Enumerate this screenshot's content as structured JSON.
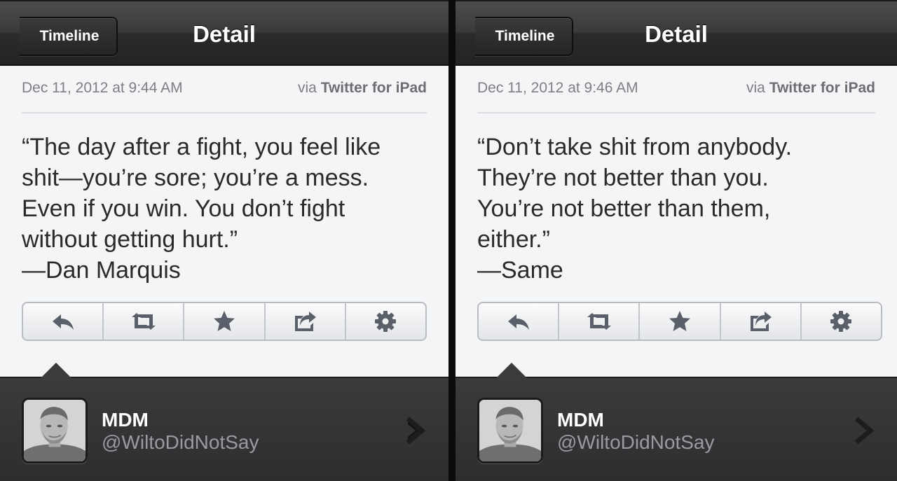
{
  "screens": [
    {
      "nav": {
        "back_label": "Timeline",
        "title": "Detail"
      },
      "tweet": {
        "date": "Dec 11, 2012 at 9:44 AM",
        "via_prefix": "via",
        "via_source": "Twitter for iPad",
        "lines": [
          "“The day after a fight, you feel like",
          "shit—you’re sore; you’re a mess.",
          "Even if you win. You don’t fight",
          "without getting hurt.”",
          "—Dan Marquis"
        ]
      },
      "actions": [
        "reply-icon",
        "retweet-icon",
        "star-icon",
        "share-icon",
        "gear-icon"
      ],
      "profile": {
        "name": "MDM",
        "handle": "@WiltoDidNotSay"
      }
    },
    {
      "nav": {
        "back_label": "Timeline",
        "title": "Detail"
      },
      "tweet": {
        "date": "Dec 11, 2012 at 9:46 AM",
        "via_prefix": "via",
        "via_source": "Twitter for iPad",
        "lines": [
          "“Don’t take shit from anybody.",
          "They’re not better than you.",
          "You’re not better than them,",
          "either.”",
          "—Same"
        ]
      },
      "actions": [
        "reply-icon",
        "retweet-icon",
        "star-icon",
        "share-icon",
        "gear-icon"
      ],
      "profile": {
        "name": "MDM",
        "handle": "@WiltoDidNotSay"
      }
    }
  ],
  "colors": {
    "navbar": "#3a3a3c",
    "content_bg": "#f4f5f7",
    "meta_text": "#7d7f82",
    "body_text": "#2a2a2a",
    "icon": "#5a6069",
    "profile_bg": "#353537"
  }
}
